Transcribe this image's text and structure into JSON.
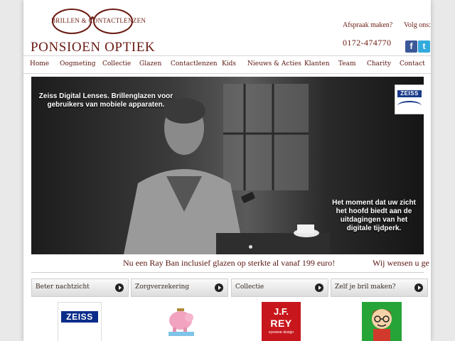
{
  "header": {
    "logo_subtitle": "BRILLEN & CONTACTLENZEN",
    "logo_title": "PONSIOEN OPTIEK",
    "appointment_label": "Afspraak maken?",
    "phone": "0172-474770",
    "follow_label": "Volg ons:",
    "social": [
      {
        "icon": "facebook-icon",
        "glyph": "f",
        "color": "#3b5998"
      },
      {
        "icon": "twitter-icon",
        "glyph": "t",
        "color": "#33aadd"
      }
    ]
  },
  "nav": {
    "items": [
      "Home",
      "Oogmeting",
      "Collectie",
      "Glazen",
      "Contactlenzen",
      "Kids",
      "Nieuws & Acties",
      "Klanten",
      "Team",
      "Charity",
      "Contact"
    ]
  },
  "hero": {
    "text_left": "Zeiss Digital Lenses. Brillenglazen voor gebruikers van mobiele apparaten.",
    "text_right": "Het moment dat uw zicht het hoofd biedt aan de uitdagingen van het digitale tijdperk.",
    "badge_brand": "ZEISS"
  },
  "ticker": {
    "text": "Nu een Ray Ban inclusief glazen op sterkte al vanaf 199 euro!",
    "text2": "Wij wensen u ge"
  },
  "tiles": [
    {
      "label": "Beter nachtzicht"
    },
    {
      "label": "Zorgverzekering"
    },
    {
      "label": "Collectie"
    },
    {
      "label": "Zelf je bril maken?"
    }
  ],
  "thumbs": {
    "zeiss": "ZEISS",
    "jfrey_top": "J.F.",
    "jfrey_main": "REY",
    "jfrey_sub": "eyewear design"
  },
  "colors": {
    "brand": "#6a1a12",
    "zeiss_blue": "#0a2d8a",
    "jfrey_red": "#c8171c"
  }
}
